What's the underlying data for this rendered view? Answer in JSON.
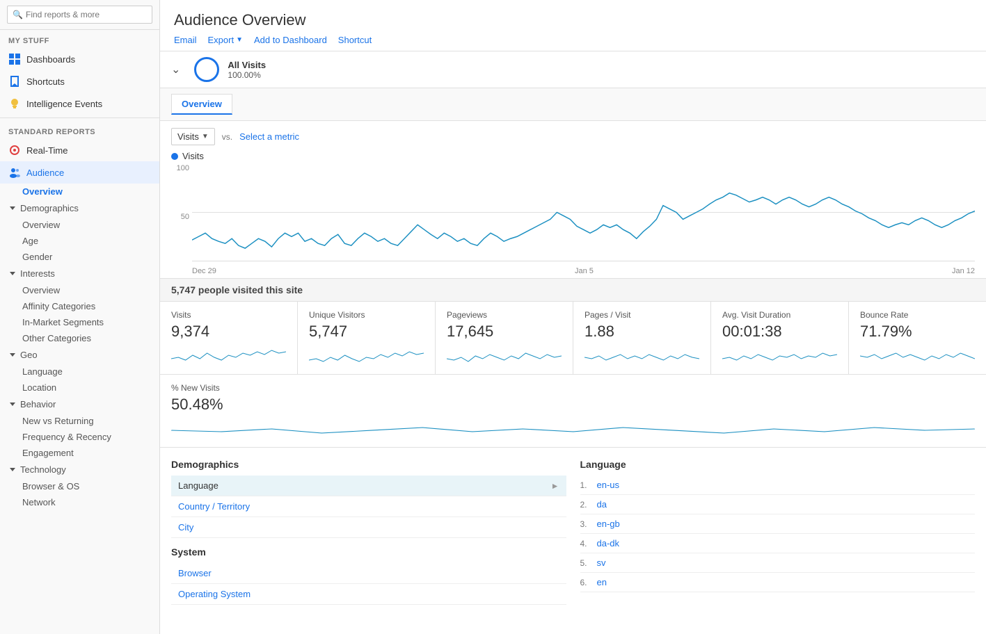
{
  "search": {
    "placeholder": "Find reports & more"
  },
  "sidebar": {
    "my_stuff_label": "MY STUFF",
    "standard_reports_label": "STANDARD REPORTS",
    "items_my_stuff": [
      {
        "id": "dashboards",
        "label": "Dashboards",
        "icon": "grid-icon"
      },
      {
        "id": "shortcuts",
        "label": "Shortcuts",
        "icon": "bookmark-icon"
      },
      {
        "id": "intelligence",
        "label": "Intelligence Events",
        "icon": "lightbulb-icon"
      }
    ],
    "items_standard": [
      {
        "id": "realtime",
        "label": "Real-Time",
        "icon": "circle-icon"
      },
      {
        "id": "audience",
        "label": "Audience",
        "icon": "people-icon"
      }
    ],
    "audience_tree": {
      "overview_label": "Overview",
      "sections": [
        {
          "label": "Demographics",
          "children": [
            "Overview",
            "Age",
            "Gender"
          ]
        },
        {
          "label": "Interests",
          "children": [
            "Overview",
            "Affinity Categories",
            "In-Market Segments",
            "Other Categories"
          ]
        },
        {
          "label": "Geo",
          "children": [
            "Language",
            "Location"
          ]
        },
        {
          "label": "Behavior",
          "children": [
            "New vs Returning",
            "Frequency & Recency",
            "Engagement"
          ]
        },
        {
          "label": "Technology",
          "children": [
            "Browser & OS",
            "Network"
          ]
        }
      ]
    }
  },
  "page": {
    "title": "Audience Overview",
    "toolbar": {
      "email": "Email",
      "export": "Export",
      "add_to_dashboard": "Add to Dashboard",
      "shortcut": "Shortcut"
    },
    "segment": {
      "name": "All Visits",
      "percentage": "100.00%"
    },
    "overview_tab": "Overview",
    "metric": {
      "selected": "Visits",
      "vs_label": "vs.",
      "select_placeholder": "Select a metric"
    },
    "chart": {
      "legend_label": "Visits",
      "y_labels": [
        "100",
        "50",
        ""
      ],
      "x_labels": [
        "Dec 29",
        "Jan 5",
        "Jan 12"
      ]
    },
    "stats_header": "5,747 people visited this site",
    "stats": [
      {
        "label": "Visits",
        "value": "9,374"
      },
      {
        "label": "Unique Visitors",
        "value": "5,747"
      },
      {
        "label": "Pageviews",
        "value": "17,645"
      },
      {
        "label": "Pages / Visit",
        "value": "1.88"
      },
      {
        "label": "Avg. Visit Duration",
        "value": "00:01:38"
      },
      {
        "label": "Bounce Rate",
        "value": "71.79%"
      },
      {
        "label": "% New Visits",
        "value": "50.48%"
      }
    ],
    "demographics_section": {
      "title": "Demographics",
      "rows": [
        {
          "label": "Language",
          "type": "active"
        },
        {
          "label": "Country / Territory",
          "type": "link"
        },
        {
          "label": "City",
          "type": "link"
        }
      ],
      "system_title": "System",
      "system_rows": [
        {
          "label": "Browser",
          "type": "link"
        },
        {
          "label": "Operating System",
          "type": "link"
        }
      ]
    },
    "language_section": {
      "title": "Language",
      "items": [
        {
          "num": "1.",
          "value": "en-us"
        },
        {
          "num": "2.",
          "value": "da"
        },
        {
          "num": "3.",
          "value": "en-gb"
        },
        {
          "num": "4.",
          "value": "da-dk"
        },
        {
          "num": "5.",
          "value": "sv"
        },
        {
          "num": "6.",
          "value": "en"
        }
      ]
    }
  },
  "colors": {
    "blue": "#1a73e8",
    "chart_line": "#1a8fc1",
    "active_bg": "#e8f4f8"
  }
}
